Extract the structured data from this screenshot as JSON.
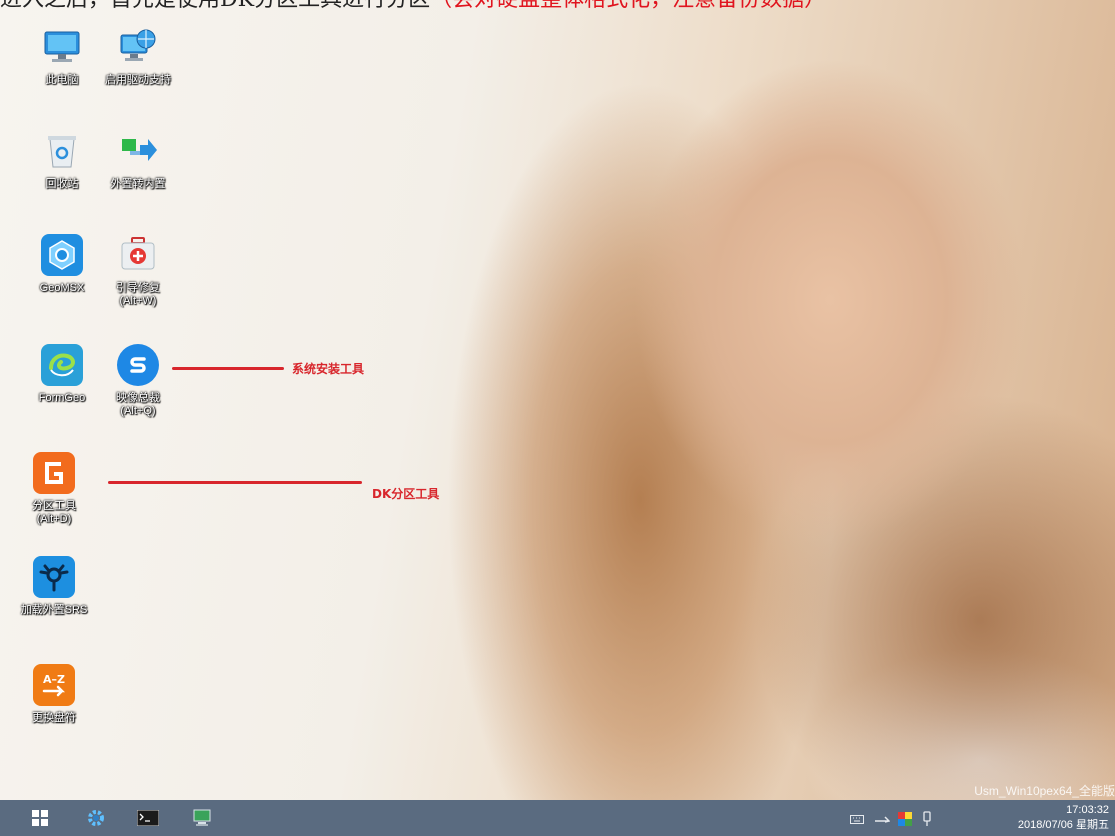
{
  "caption": {
    "text": "进入之后，首先是使用DK分区工具进行分区",
    "highlight": "（会对硬盘整体格式化，注意备份数据）"
  },
  "desktop_icons": [
    {
      "name": "this-pc",
      "label": "此电脑",
      "icon": "computer-icon"
    },
    {
      "name": "enable-driver-support",
      "label": "启用驱动支持",
      "icon": "network-computer-icon"
    },
    {
      "name": "recycle-bin",
      "label": "回收站",
      "icon": "recycle-bin-icon"
    },
    {
      "name": "external-to-internal",
      "label": "外置转内置",
      "icon": "transfer-arrow-icon"
    },
    {
      "name": "geomsx",
      "label": "GeoMSX",
      "icon": "geomsx-icon"
    },
    {
      "name": "boot-repair",
      "label": "引导修复",
      "sublabel": "(Alt+W)",
      "icon": "first-aid-icon"
    },
    {
      "name": "formgeo",
      "label": "FormGeo",
      "icon": "formgeo-icon"
    },
    {
      "name": "image-master",
      "label": "映像总裁",
      "sublabel": "(Alt+Q)",
      "icon": "sgi-icon"
    },
    {
      "name": "partition-tool",
      "label": "分区工具",
      "sublabel": "(Alt+D)",
      "icon": "diskgenius-icon"
    },
    {
      "name": "load-external-srs",
      "label": "加载外置SRS",
      "icon": "firewire-icon"
    },
    {
      "name": "change-drive-letter",
      "label": "更换盘符",
      "icon": "az-icon"
    }
  ],
  "annotations": {
    "system_install": "系统安装工具",
    "dk_partition": "DK分区工具"
  },
  "watermark": "Usm_Win10pex64_全能版",
  "taskbar": {
    "items": [
      "start-icon",
      "settings-gear-icon",
      "terminal-icon",
      "monitor-icon"
    ],
    "tray": [
      "keyboard-icon",
      "network-icon",
      "color-display-icon",
      "usb-icon"
    ],
    "time": "17:03:32",
    "date": "2018/07/06 星期五"
  },
  "colors": {
    "annotation": "#d8262c",
    "taskbar": "#5a6b80"
  }
}
